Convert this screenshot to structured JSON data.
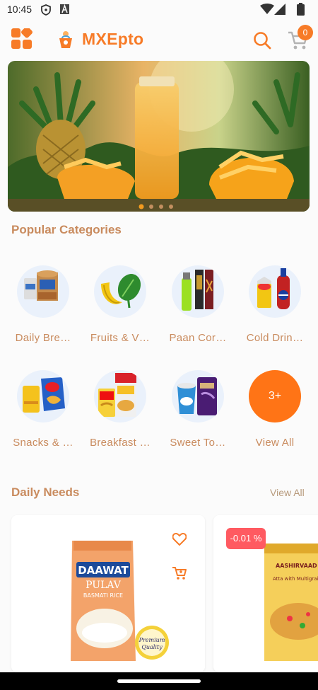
{
  "status_bar": {
    "time": "10:45",
    "icons": [
      "shield-icon",
      "a-icon",
      "wifi-icon",
      "signal-icon",
      "battery-icon"
    ]
  },
  "header": {
    "brand": "MXEpto",
    "cart_count": "0",
    "accent": "#f77b27"
  },
  "banner": {
    "description_icons": [
      "pineapple",
      "juice-bottle",
      "mango"
    ],
    "carousel_dots": 4,
    "active_dot": 0
  },
  "popular_categories": {
    "title": "Popular Categories",
    "items": [
      {
        "label": "Daily Bre…",
        "icon": "bread-icon"
      },
      {
        "label": "Fruits & V…",
        "icon": "fruits-icon"
      },
      {
        "label": "Paan Cor…",
        "icon": "paan-icon"
      },
      {
        "label": "Cold Drin…",
        "icon": "cold-drinks-icon"
      },
      {
        "label": "Snacks & …",
        "icon": "snacks-icon"
      },
      {
        "label": "Breakfast …",
        "icon": "breakfast-icon"
      },
      {
        "label": "Sweet To…",
        "icon": "sweet-icon"
      },
      {
        "label": "View All",
        "badge": "3+"
      }
    ]
  },
  "daily_needs": {
    "title": "Daily Needs",
    "view_all": "View All",
    "products": [
      {
        "brand": "DAAWAT",
        "line1": "PULAV",
        "line2": "BASMATI RICE",
        "seal": "Premium Quality"
      },
      {
        "discount": "-0.01 %",
        "brand": "AASHIRVAAD",
        "line1": "Atta with Multigrains"
      }
    ]
  }
}
